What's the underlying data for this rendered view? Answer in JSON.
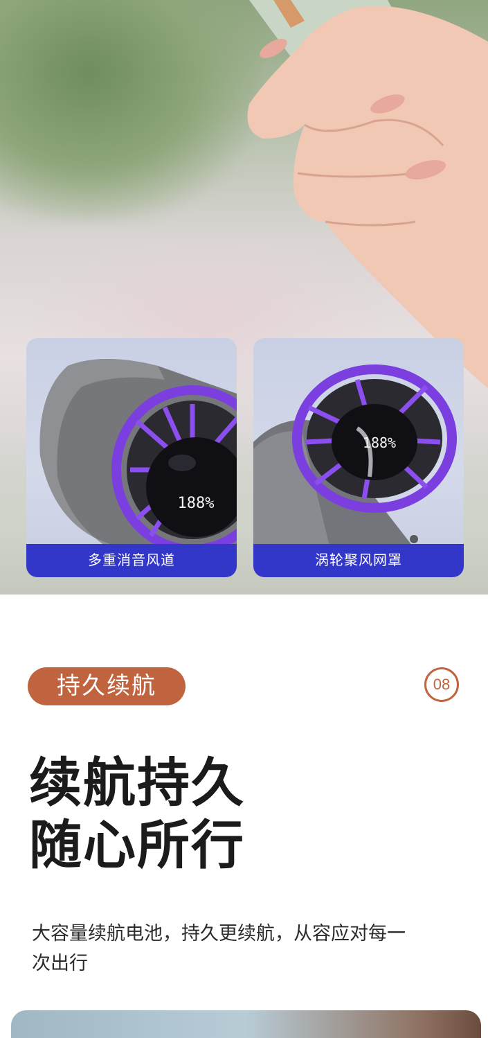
{
  "features": [
    {
      "label": "多重消音风道",
      "display": "188%"
    },
    {
      "label": "涡轮聚风网罩",
      "display": "188%"
    }
  ],
  "section": {
    "tag": "持久续航",
    "number": "08",
    "headline_line1": "续航持久",
    "headline_line2": "随心所行",
    "description": "大容量续航电池，持久更续航，从容应对每一次出行"
  },
  "colors": {
    "accent": "#c0643f",
    "caption_bg": "#3337c9",
    "ring_purple": "#7b3fe0"
  }
}
